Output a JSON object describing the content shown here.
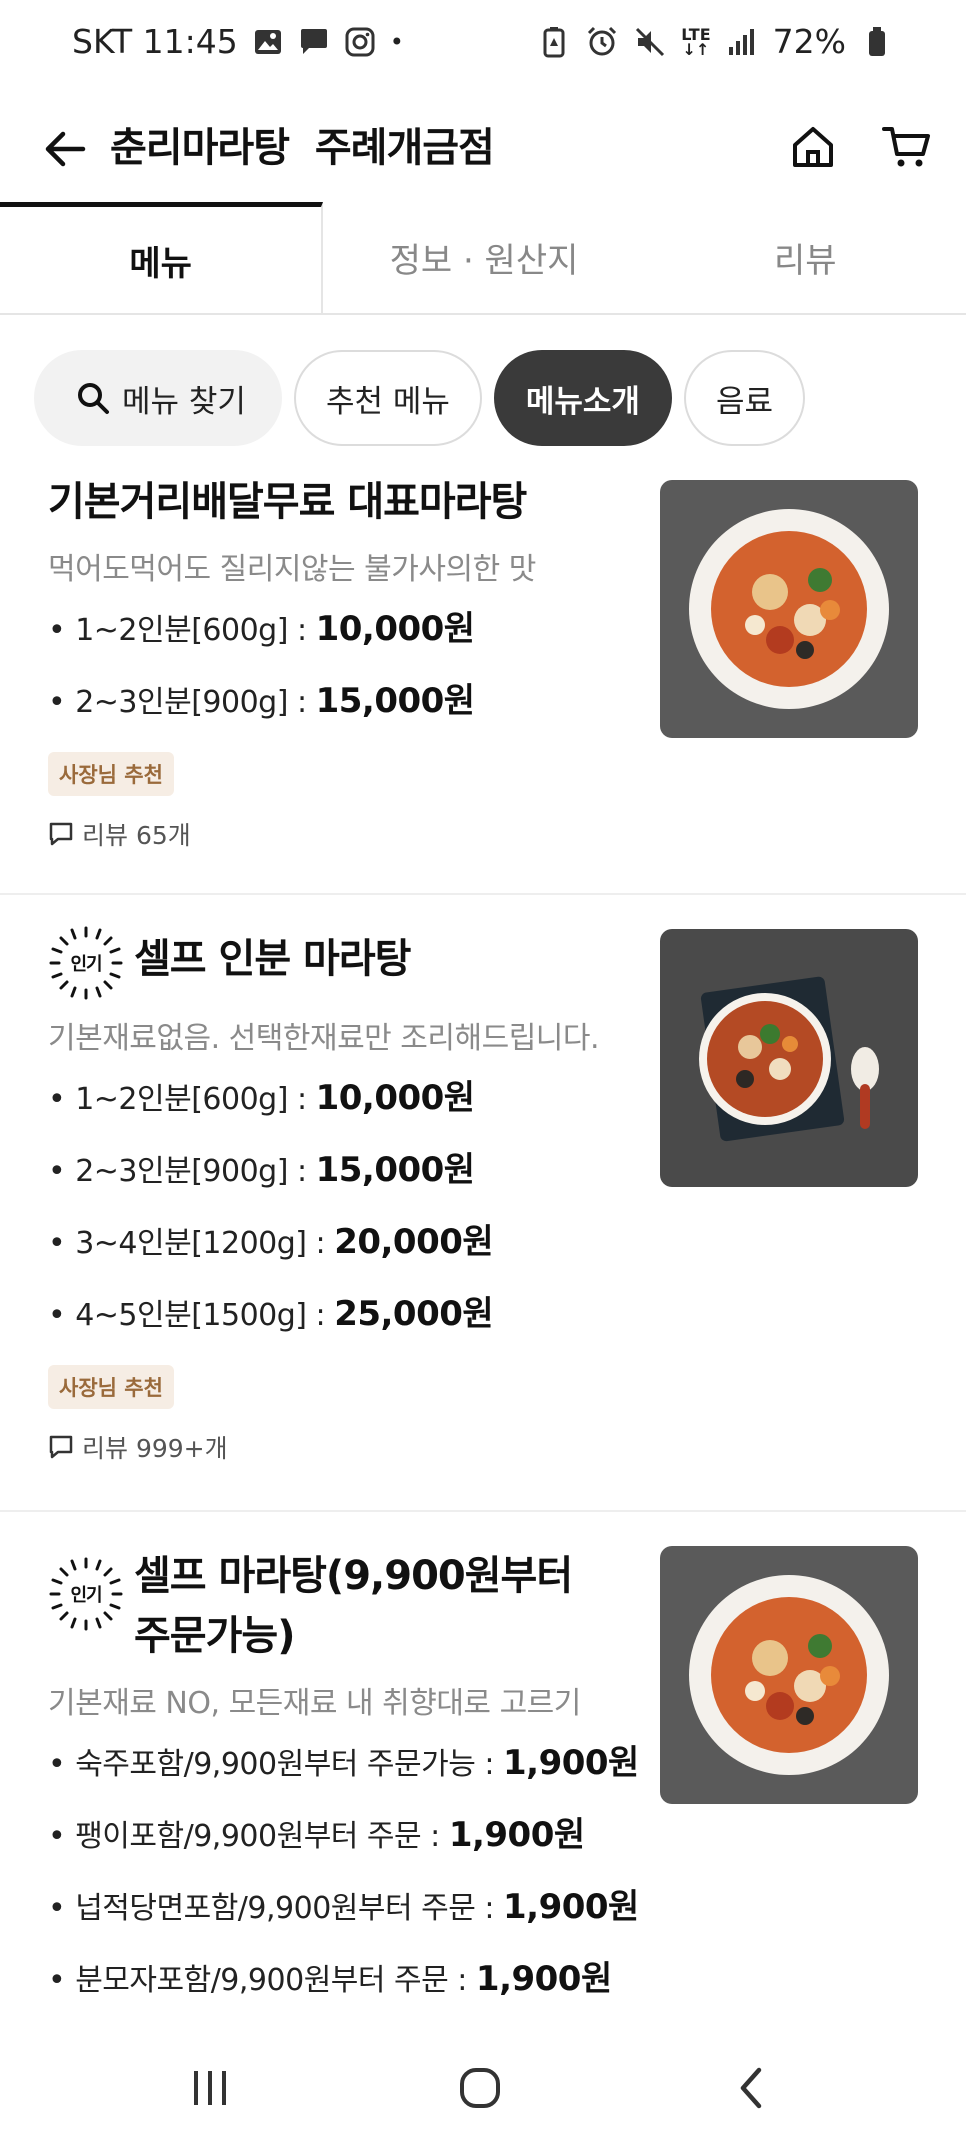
{
  "status_bar": {
    "carrier_time": "SKT 11:45",
    "dot": "•",
    "lte": "LTE",
    "battery": "72%"
  },
  "header": {
    "title": "춘리마라탕  주례개금점"
  },
  "tabs": [
    {
      "label": "메뉴",
      "active": true
    },
    {
      "label": "정보 · 원산지",
      "active": false
    },
    {
      "label": "리뷰",
      "active": false
    }
  ],
  "chips": {
    "search": "메뉴 찾기",
    "items": [
      "추천 메뉴",
      "메뉴소개",
      "음료"
    ],
    "selected": "메뉴소개"
  },
  "menu": [
    {
      "name": "기본거리배달무료 대표마라탕",
      "popular": false,
      "description": "먹어도먹어도 질리지않는 불가사의한 맛",
      "options": [
        {
          "label": "1~2인분[600g] : ",
          "price": "10,000원"
        },
        {
          "label": "2~3인분[900g] : ",
          "price": "15,000원"
        }
      ],
      "badge": "사장님 추천",
      "reviews": "리뷰 65개"
    },
    {
      "name": "셀프 인분 마라탕",
      "popular": true,
      "popular_label": "인기",
      "description": "기본재료없음. 선택한재료만 조리해드립니다.",
      "options": [
        {
          "label": "1~2인분[600g] : ",
          "price": "10,000원"
        },
        {
          "label": "2~3인분[900g] : ",
          "price": "15,000원"
        },
        {
          "label": "3~4인분[1200g] : ",
          "price": "20,000원"
        },
        {
          "label": "4~5인분[1500g] : ",
          "price": "25,000원"
        }
      ],
      "badge": "사장님 추천",
      "reviews": "리뷰 999+개"
    },
    {
      "name_line1": "셀프 마라탕(9,900원부터",
      "name_line2": "주문가능)",
      "popular": true,
      "popular_label": "인기",
      "description": "기본재료 NO, 모든재료 내 취향대로 고르기",
      "options": [
        {
          "label": "숙주포함/9,900원부터 주문가능 : ",
          "price": "1,900원"
        },
        {
          "label": "팽이포함/9,900원부터 주문 : ",
          "price": "1,900원"
        },
        {
          "label": "넙적당면포함/9,900원부터 주문 : ",
          "price": "1,900원"
        },
        {
          "label": "분모자포함/9,900원부터 주문 : ",
          "price": "1,900원"
        }
      ]
    }
  ],
  "colors": {
    "accent_dark": "#3a3a3a",
    "badge_bg": "#f6ede4",
    "badge_text": "#9a6a3b",
    "muted_text": "#8a8a8a"
  },
  "icons": [
    "back-arrow-icon",
    "home-icon",
    "cart-icon",
    "search-icon",
    "review-bubble-icon",
    "popular-burst-icon"
  ]
}
